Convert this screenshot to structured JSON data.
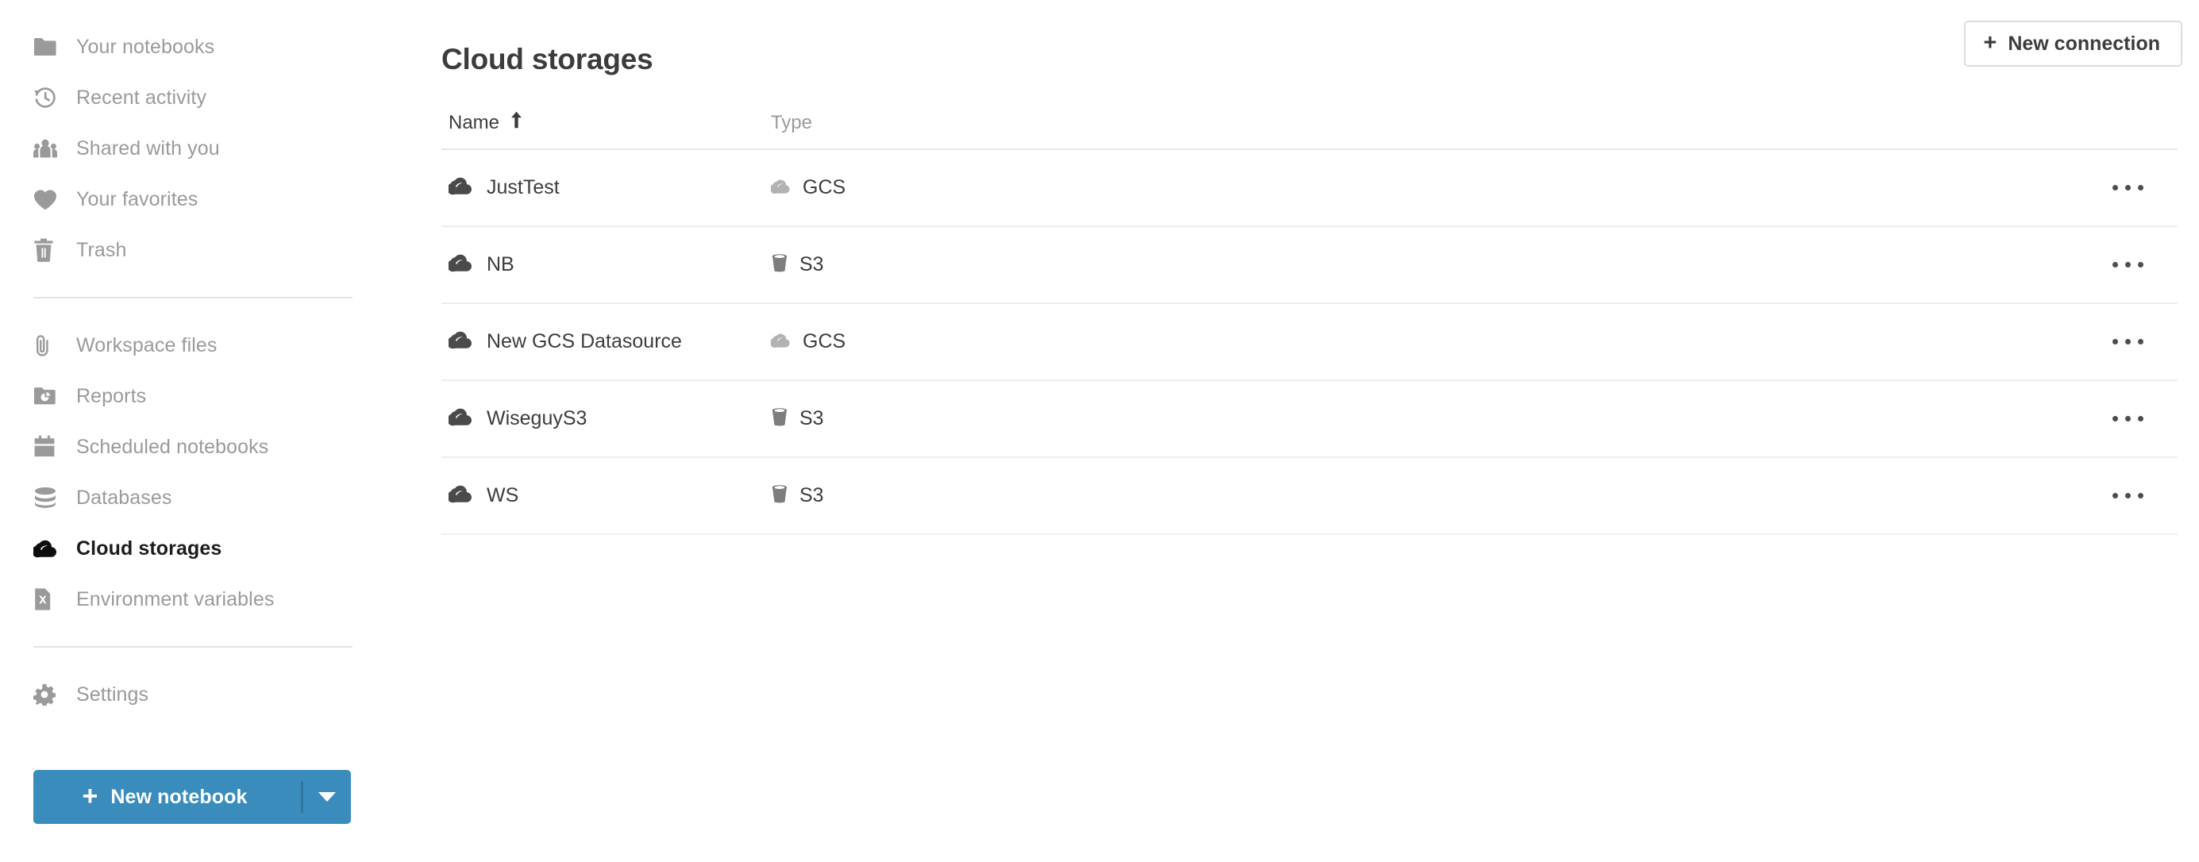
{
  "sidebar": {
    "groups": [
      {
        "items": [
          {
            "label": "Your notebooks",
            "icon": "folder-icon",
            "name": "your-notebooks",
            "active": false
          },
          {
            "label": "Recent activity",
            "icon": "history-clock-icon",
            "name": "recent-activity",
            "active": false
          },
          {
            "label": "Shared with you",
            "icon": "people-group-icon",
            "name": "shared-with-you",
            "active": false
          },
          {
            "label": "Your favorites",
            "icon": "heart-icon",
            "name": "your-favorites",
            "active": false
          },
          {
            "label": "Trash",
            "icon": "trash-icon",
            "name": "trash",
            "active": false
          }
        ]
      },
      {
        "items": [
          {
            "label": "Workspace files",
            "icon": "paperclip-icon",
            "name": "workspace-files",
            "active": false
          },
          {
            "label": "Reports",
            "icon": "report-folder-icon",
            "name": "reports",
            "active": false
          },
          {
            "label": "Scheduled notebooks",
            "icon": "calendar-icon",
            "name": "scheduled-notebooks",
            "active": false
          },
          {
            "label": "Databases",
            "icon": "database-icon",
            "name": "databases",
            "active": false
          },
          {
            "label": "Cloud storages",
            "icon": "cloud-icon",
            "name": "cloud-storages",
            "active": true
          },
          {
            "label": "Environment variables",
            "icon": "x-file-icon",
            "name": "environment-variables",
            "active": false
          }
        ]
      },
      {
        "items": [
          {
            "label": "Settings",
            "icon": "gear-icon",
            "name": "settings",
            "active": false
          }
        ]
      }
    ],
    "new_notebook": {
      "label": "New notebook",
      "plus": "+",
      "caret_icon": "chevron-down-icon"
    }
  },
  "header": {
    "title": "Cloud storages",
    "new_connection": {
      "label": "New connection",
      "plus": "+"
    }
  },
  "table": {
    "columns": [
      {
        "label": "Name",
        "sorted": true,
        "sort_direction": "asc",
        "sort_icon": "arrow-up-icon"
      },
      {
        "label": "Type",
        "sorted": false
      }
    ],
    "rows": [
      {
        "name": "JustTest",
        "name_icon": "cloud-icon",
        "type": "GCS",
        "type_icon": "gcs-cloud-icon",
        "menu_icon": "more-horizontal-icon"
      },
      {
        "name": "NB",
        "name_icon": "cloud-icon",
        "type": "S3",
        "type_icon": "s3-bucket-icon",
        "menu_icon": "more-horizontal-icon"
      },
      {
        "name": "New GCS Datasource",
        "name_icon": "cloud-icon",
        "type": "GCS",
        "type_icon": "gcs-cloud-icon",
        "menu_icon": "more-horizontal-icon"
      },
      {
        "name": "WiseguyS3",
        "name_icon": "cloud-icon",
        "type": "S3",
        "type_icon": "s3-bucket-icon",
        "menu_icon": "more-horizontal-icon"
      },
      {
        "name": "WS",
        "name_icon": "cloud-icon",
        "type": "S3",
        "type_icon": "s3-bucket-icon",
        "menu_icon": "more-horizontal-icon"
      }
    ]
  },
  "colors": {
    "accent_blue": "#3a8cbd",
    "nav_inactive": "#9a9a9a",
    "nav_active": "#1c1c1c",
    "text_primary": "#3c3c3c",
    "divider": "#e6e6e6"
  }
}
